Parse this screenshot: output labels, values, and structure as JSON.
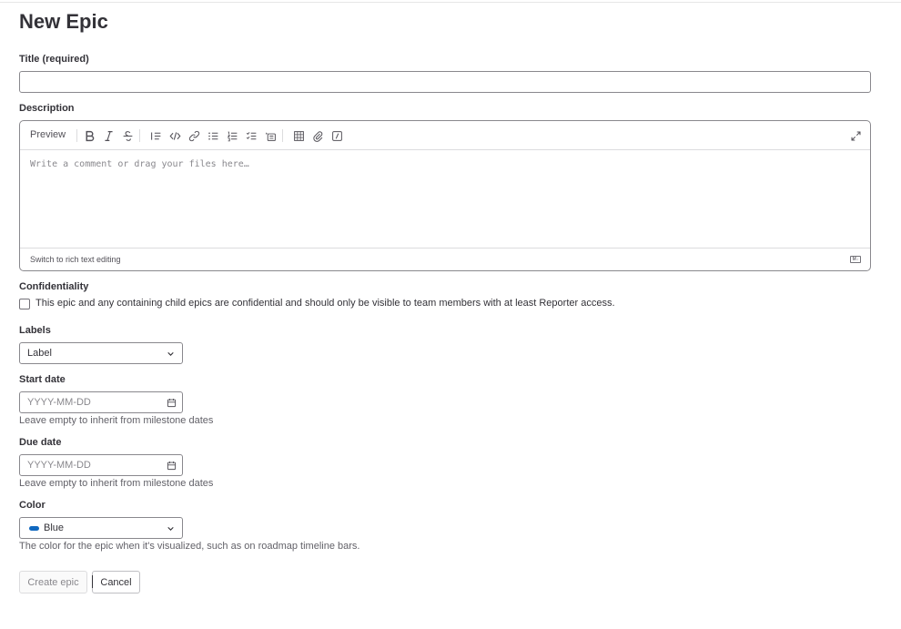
{
  "page": {
    "title": "New Epic"
  },
  "title_field": {
    "label": "Title (required)",
    "value": ""
  },
  "description": {
    "label": "Description",
    "preview_tab": "Preview",
    "placeholder": "Write a comment or drag your files here…",
    "rich_text_link": "Switch to rich text editing",
    "markdown_badge": "M↓",
    "toolbar_icons": [
      "bold-icon",
      "italic-icon",
      "strikethrough-icon",
      "quote-icon",
      "code-icon",
      "link-icon",
      "bullet-list-icon",
      "numbered-list-icon",
      "task-list-icon",
      "collapsible-icon",
      "table-icon",
      "attachment-icon",
      "quick-action-icon",
      "fullscreen-icon"
    ]
  },
  "confidentiality": {
    "label": "Confidentiality",
    "checkbox_text": "This epic and any containing child epics are confidential and should only be visible to team members with at least Reporter access.",
    "checked": false
  },
  "labels": {
    "label": "Labels",
    "selected": "Label"
  },
  "start_date": {
    "label": "Start date",
    "placeholder": "YYYY-MM-DD",
    "help": "Leave empty to inherit from milestone dates"
  },
  "due_date": {
    "label": "Due date",
    "placeholder": "YYYY-MM-DD",
    "help": "Leave empty to inherit from milestone dates"
  },
  "color": {
    "label": "Color",
    "selected": "Blue",
    "swatch": "#1068bf",
    "help": "The color for the epic when it's visualized, such as on roadmap timeline bars."
  },
  "actions": {
    "create": "Create epic",
    "cancel": "Cancel"
  }
}
